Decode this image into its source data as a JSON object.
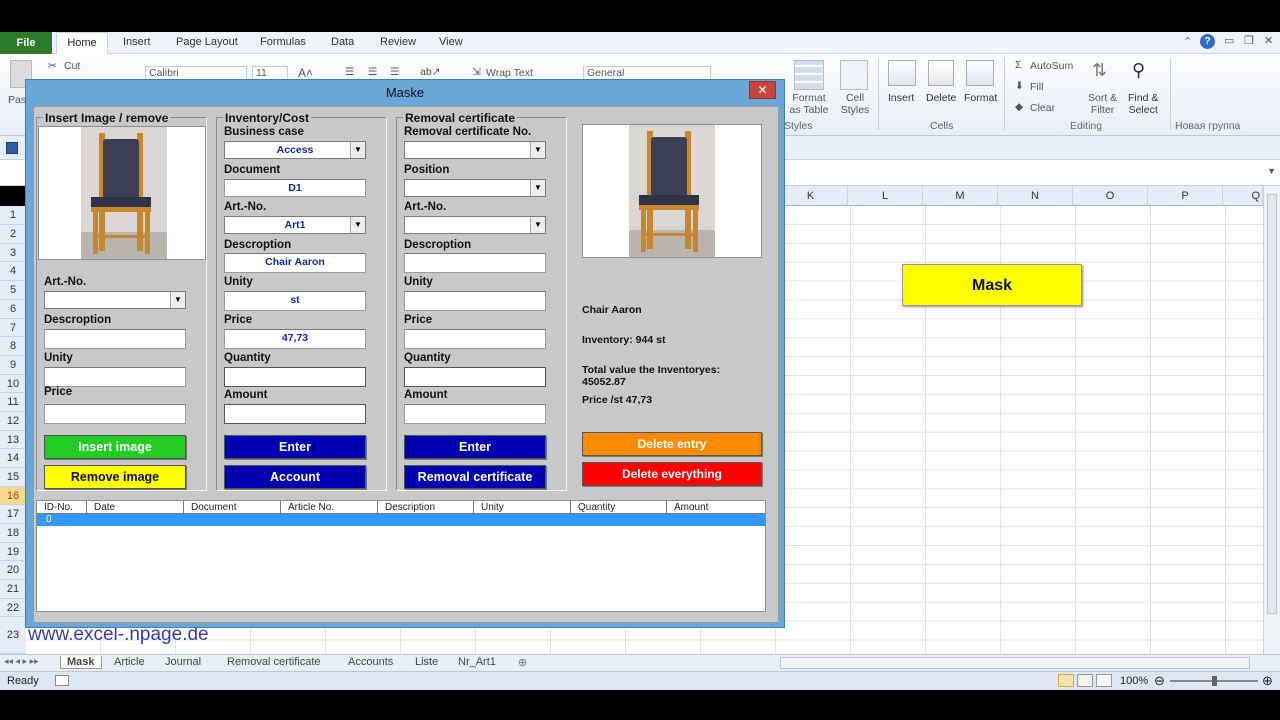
{
  "ribbon": {
    "file_tab": "File",
    "tabs": [
      "Home",
      "Insert",
      "Page Layout",
      "Formulas",
      "Data",
      "Review",
      "View"
    ],
    "clipboard": {
      "paste": "Pas",
      "cut": "Cut"
    },
    "font": {
      "family": "Calibri",
      "size": "11"
    },
    "alignment": {
      "wrap_text": "Wrap Text"
    },
    "number": {
      "format": "General"
    },
    "styles": {
      "format_as_table": "Format\nas Table",
      "cell_styles": "Cell\nStyles",
      "group": "Styles"
    },
    "cells": {
      "insert": "Insert",
      "delete": "Delete",
      "format": "Format",
      "group": "Cells"
    },
    "editing": {
      "autosum": "AutoSum",
      "fill": "Fill",
      "clear": "Clear",
      "sort_filter": "Sort &\nFilter",
      "find_select": "Find &\nSelect",
      "group": "Editing"
    },
    "new_group": "Новая группа"
  },
  "sheet": {
    "columns": [
      "K",
      "L",
      "M",
      "N",
      "O",
      "P",
      "Q"
    ],
    "rows": [
      "1",
      "2",
      "3",
      "4",
      "5",
      "6",
      "7",
      "8",
      "9",
      "10",
      "11",
      "12",
      "13",
      "14",
      "15",
      "16",
      "17",
      "18",
      "19",
      "20",
      "21",
      "22",
      "23"
    ],
    "mask_button": "Mask",
    "website": "www.excel-.npage.de",
    "tabs": [
      "Mask",
      "Article",
      "Journal",
      "Removal certificate",
      "Accounts",
      "Liste",
      "Nr_Art1"
    ]
  },
  "status": {
    "ready": "Ready",
    "zoom": "100%"
  },
  "dialog": {
    "title": "Maske",
    "close": "✕",
    "image_frame": {
      "title": "Insert Image / remove",
      "art_no_label": "Art.-No.",
      "art_no_value": "",
      "description_label": "Descroption",
      "unity_label": "Unity",
      "price_label": "Price",
      "insert_button": "Insert image",
      "remove_button": "Remove image"
    },
    "inventory_frame": {
      "title": "Inventory/Cost",
      "business_case_label": "Business case",
      "business_case_value": "Access",
      "document_label": "Document",
      "document_value": "D1",
      "art_no_label": "Art.-No.",
      "art_no_value": "Art1",
      "description_label": "Descroption",
      "description_value": "Chair Aaron",
      "unity_label": "Unity",
      "unity_value": "st",
      "price_label": "Price",
      "price_value": "47,73",
      "quantity_label": "Quantity",
      "amount_label": "Amount",
      "enter_button": "Enter",
      "account_button": "Account"
    },
    "removal_frame": {
      "title": "Removal certificate",
      "cert_no_label": "Removal certificate No.",
      "position_label": "Position",
      "art_no_label": "Art.-No.",
      "description_label": "Descroption",
      "unity_label": "Unity",
      "price_label": "Price",
      "quantity_label": "Quantity",
      "amount_label": "Amount",
      "enter_button": "Enter",
      "removal_button": "Removal certificate"
    },
    "info": {
      "name": "Chair Aaron",
      "inventory": "Inventory: 944 st",
      "total_value": "Total value the Inventoryes:\n45052.87",
      "price": "Price /st 47,73"
    },
    "delete_entry_button": "Delete entry",
    "delete_all_button": "Delete everything",
    "list": {
      "headers": [
        "ID-No.",
        "Date",
        "Document",
        "Article No.",
        "Description",
        "Unity",
        "Quantity",
        "Amount"
      ],
      "rows": [
        [
          "0",
          "",
          "",
          "",
          "",
          "",
          "",
          ""
        ]
      ]
    }
  },
  "colors": {
    "green_button": "#22cc22",
    "yellow_button": "#ffff00",
    "blue_button": "#0000b0",
    "orange_button": "#ff8c00",
    "red_button": "#ff0000",
    "dialog_frame": "#6aa6d8",
    "selected_row": "#3399ff"
  }
}
